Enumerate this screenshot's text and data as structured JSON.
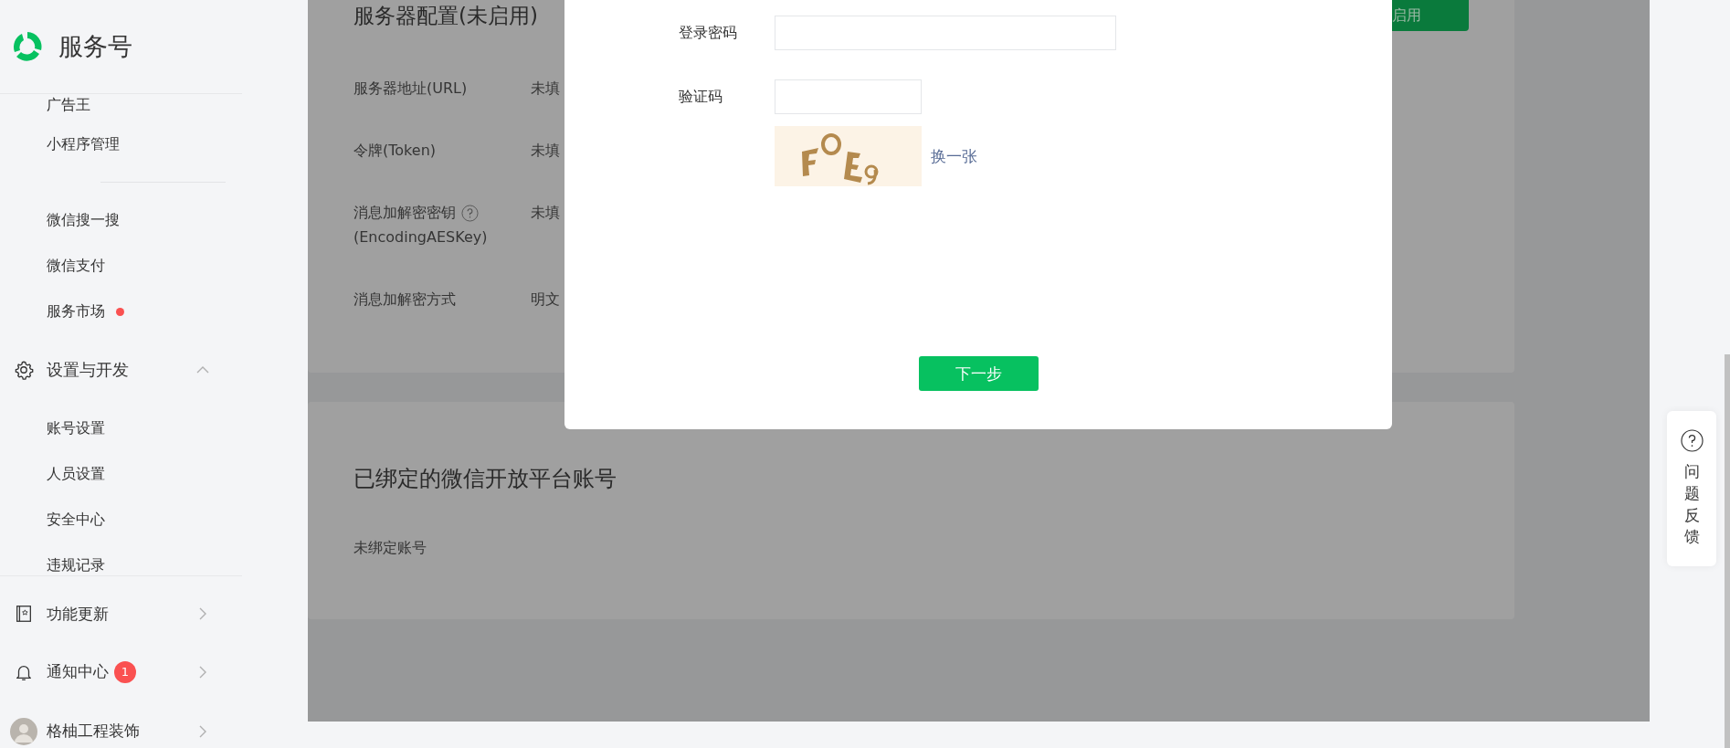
{
  "sidebar": {
    "brand": "服务号",
    "items": [
      {
        "kind": "item",
        "label": "广告王",
        "dot": false
      },
      {
        "kind": "item",
        "label": "小程序管理",
        "dot": false
      },
      {
        "kind": "divider"
      },
      {
        "kind": "item",
        "label": "微信搜一搜",
        "dot": false
      },
      {
        "kind": "item",
        "label": "微信支付",
        "dot": false
      },
      {
        "kind": "item",
        "label": "服务市场",
        "dot": true
      },
      {
        "kind": "section",
        "label": "设置与开发",
        "expanded": true
      },
      {
        "kind": "item",
        "label": "账号设置",
        "dot": false
      },
      {
        "kind": "item",
        "label": "人员设置",
        "dot": false
      },
      {
        "kind": "item",
        "label": "安全中心",
        "dot": false
      },
      {
        "kind": "item",
        "label": "违规记录",
        "dot": false
      }
    ],
    "bottom": [
      {
        "label": "功能更新"
      },
      {
        "label": "通知中心",
        "badge": "1"
      },
      {
        "label": "格柚工程装饰"
      }
    ]
  },
  "server_config": {
    "title": "服务器配置(未启用)",
    "enable_button": "启用",
    "rows": [
      {
        "label": "服务器地址(URL)",
        "value": "未填",
        "help": false
      },
      {
        "label": "令牌(Token)",
        "value": "未填",
        "help": false
      },
      {
        "label": "消息加解密密钥",
        "sublabel": "(EncodingAESKey)",
        "help": true,
        "value": "未填"
      },
      {
        "label": "消息加解密方式",
        "value": "明文",
        "help": false
      }
    ]
  },
  "bound_accounts": {
    "title": "已绑定的微信开放平台账号",
    "status": "未绑定账号"
  },
  "dialog": {
    "fields": [
      {
        "label": "登录密码",
        "kind": "password"
      },
      {
        "label": "验证码",
        "kind": "captcha"
      }
    ],
    "refresh_link": "换一张",
    "next_button": "下一步"
  },
  "feedback": {
    "label": "问题反馈"
  }
}
